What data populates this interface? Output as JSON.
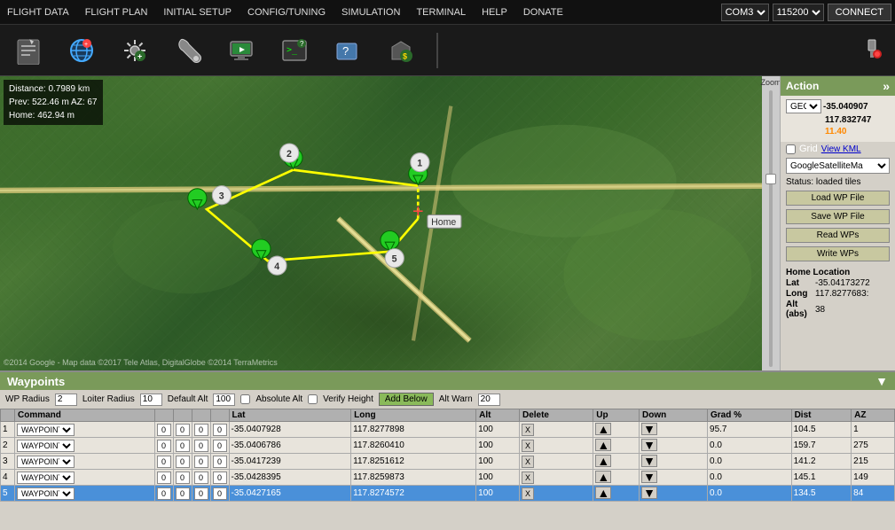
{
  "topMenu": {
    "items": [
      "FLIGHT DATA",
      "FLIGHT PLAN",
      "INITIAL SETUP",
      "CONFIG/TUNING",
      "SIMULATION",
      "TERMINAL",
      "HELP",
      "DONATE"
    ],
    "comPort": "COM3",
    "baudRate": "115200",
    "connectLabel": "CONNECT"
  },
  "toolbar": {
    "buttons": [
      {
        "name": "flight-data-icon",
        "symbol": "📋"
      },
      {
        "name": "flight-plan-icon",
        "symbol": "🌐"
      },
      {
        "name": "initial-setup-icon",
        "symbol": "⚙"
      },
      {
        "name": "config-tuning-icon",
        "symbol": "🔧"
      },
      {
        "name": "simulation-icon",
        "symbol": "🖥"
      },
      {
        "name": "terminal-icon",
        "symbol": "💻"
      },
      {
        "name": "help-icon",
        "symbol": "❓"
      },
      {
        "name": "donate-icon",
        "symbol": "💰"
      }
    ]
  },
  "mapInfo": {
    "distance": "Distance: 0.7989 km",
    "prev": "Prev: 522.46 m AZ: 67",
    "home": "Home: 462.94 m",
    "copyright": "©2014 Google - Map data ©2017 Tele Atlas, DigitalGlobe ©2014 TerraMetrics"
  },
  "rightPanel": {
    "title": "Action",
    "expandIcon": "»",
    "coordType": "GEO",
    "lat": "-35.040907",
    "lon": "117.832747",
    "alt": "11.40",
    "gridLabel": "Grid",
    "viewKmlLabel": "View KML",
    "mapType": "GoogleSatelliteMa",
    "statusLabel": "Status: loaded tiles",
    "loadWPLabel": "Load WP File",
    "saveWPLabel": "Save WP File",
    "readWPsLabel": "Read WPs",
    "writeWPsLabel": "Write WPs",
    "homeLocationTitle": "Home Location",
    "homeLat": "Lat",
    "homeLatVal": "-35.04173272",
    "homeLon": "Long",
    "homeLonVal": "117.8277683:",
    "homeAlt": "Alt (abs)",
    "homeAltVal": "38"
  },
  "waypointsPanel": {
    "title": "Waypoints",
    "wpRadius": "WP Radius",
    "wpRadiusVal": "2",
    "loiterRadius": "Loiter Radius",
    "loiterRadiusVal": "10",
    "defaultAlt": "Default Alt",
    "defaultAltVal": "100",
    "absoluteAltLabel": "Absolute Alt",
    "verifyHeightLabel": "Verify Height",
    "addBelowLabel": "Add Below",
    "altWarnLabel": "Alt Warn",
    "altWarnVal": "20",
    "tableHeaders": [
      "",
      "Command",
      "",
      "",
      "",
      "",
      "Lat",
      "Long",
      "Alt",
      "Delete",
      "Up",
      "Down",
      "Grad %",
      "Dist",
      "AZ"
    ],
    "waypoints": [
      {
        "num": 1,
        "command": "WAYPOINT",
        "p1": "0",
        "p2": "0",
        "p3": "0",
        "p4": "0",
        "lat": "-35.0407928",
        "lon": "117.8277898",
        "alt": "100",
        "grad": "95.7",
        "dist": "104.5",
        "az": "1",
        "selected": false
      },
      {
        "num": 2,
        "command": "WAYPOINT",
        "p1": "0",
        "p2": "0",
        "p3": "0",
        "p4": "0",
        "lat": "-35.0406786",
        "lon": "117.8260410",
        "alt": "100",
        "grad": "0.0",
        "dist": "159.7",
        "az": "275",
        "selected": false
      },
      {
        "num": 3,
        "command": "WAYPOINT",
        "p1": "0",
        "p2": "0",
        "p3": "0",
        "p4": "0",
        "lat": "-35.0417239",
        "lon": "117.8251612",
        "alt": "100",
        "grad": "0.0",
        "dist": "141.2",
        "az": "215",
        "selected": false
      },
      {
        "num": 4,
        "command": "WAYPOINT",
        "p1": "0",
        "p2": "0",
        "p3": "0",
        "p4": "0",
        "lat": "-35.0428395",
        "lon": "117.8259873",
        "alt": "100",
        "grad": "0.0",
        "dist": "145.1",
        "az": "149",
        "selected": false
      },
      {
        "num": 5,
        "command": "WAYPOINT",
        "p1": "0",
        "p2": "0",
        "p3": "0",
        "p4": "0",
        "lat": "-35.0427165",
        "lon": "117.8274572",
        "alt": "100",
        "grad": "0.0",
        "dist": "134.5",
        "az": "84",
        "selected": true
      }
    ]
  }
}
